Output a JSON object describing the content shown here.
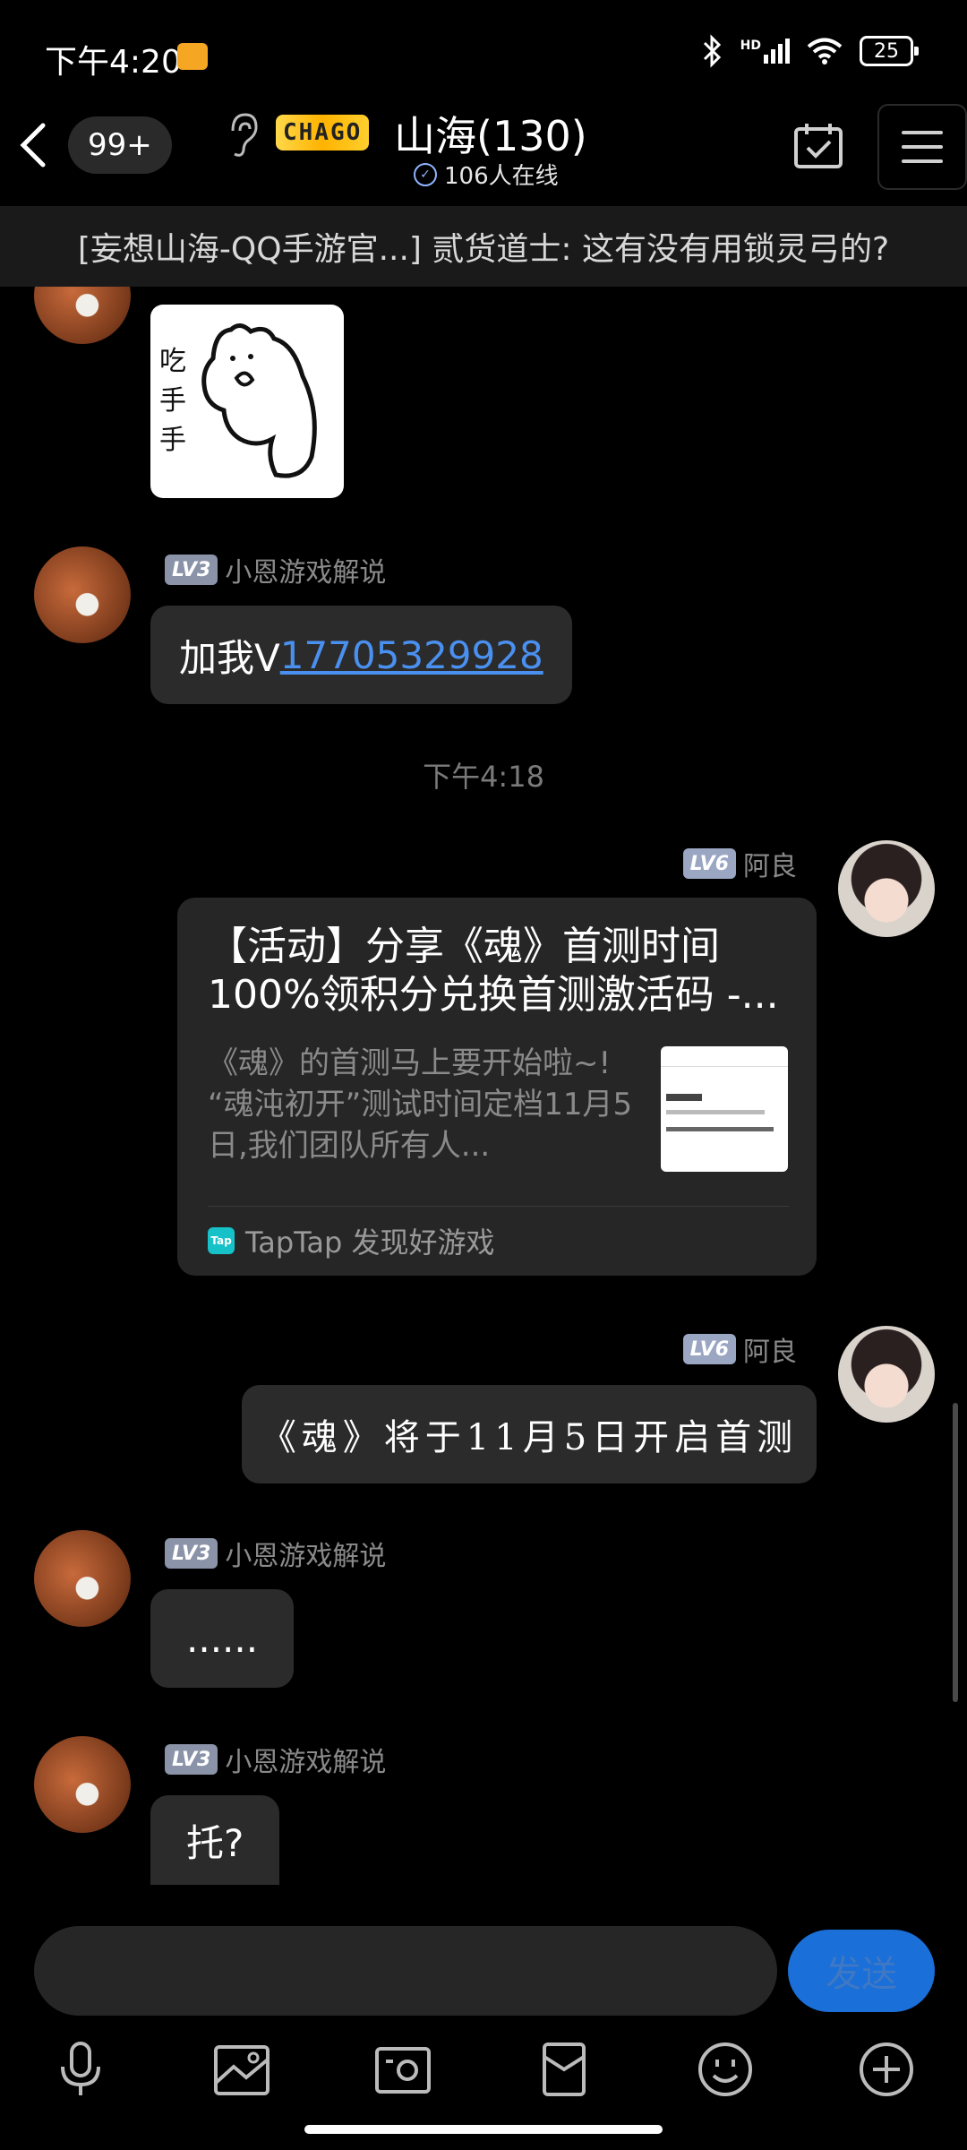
{
  "status_bar": {
    "time": "下午4:20",
    "network": "HD",
    "battery": "25"
  },
  "header": {
    "unread_count": "99+",
    "group_logo_text": "CHAGO",
    "group_name": "山海(130)",
    "online_status": "106人在线"
  },
  "notice": {
    "text": "[妄想山海-QQ手游官...] 贰货道士: 这有没有用锁灵弓的?"
  },
  "messages": [
    {
      "type": "sticker",
      "sender": "",
      "sticker_text": "吃手手"
    },
    {
      "type": "text",
      "level": "LV3",
      "sender": "小恩游戏解说",
      "prefix": "加我V",
      "link": "17705329928"
    },
    {
      "type": "time",
      "text": "下午4:18"
    },
    {
      "type": "share",
      "level": "LV6",
      "sender": "阿良",
      "title": "【活动】分享《魂》首测时间100%领积分兑换首测激活码 -...",
      "desc": "《魂》的首测马上要开始啦~! “魂沌初开”测试时间定档11月5日,我们团队所有人...",
      "source": "TapTap 发现好游戏",
      "source_icon_label": "Tap"
    },
    {
      "type": "text",
      "level": "LV6",
      "sender": "阿良",
      "text": "《魂》将于11月5日开启首测"
    },
    {
      "type": "text",
      "level": "LV3",
      "sender": "小恩游戏解说",
      "text": "......"
    },
    {
      "type": "text",
      "level": "LV3",
      "sender": "小恩游戏解说",
      "text": "托?"
    }
  ],
  "input": {
    "placeholder": "",
    "send_label": "发送"
  },
  "toolbar_icons": [
    "mic-icon",
    "image-icon",
    "camera-icon",
    "red-packet-icon",
    "emoji-icon",
    "plus-icon"
  ],
  "colors": {
    "accent": "#1a6fd8",
    "link": "#4a90f0",
    "bubble": "#2b2b2b",
    "background": "#000000"
  }
}
